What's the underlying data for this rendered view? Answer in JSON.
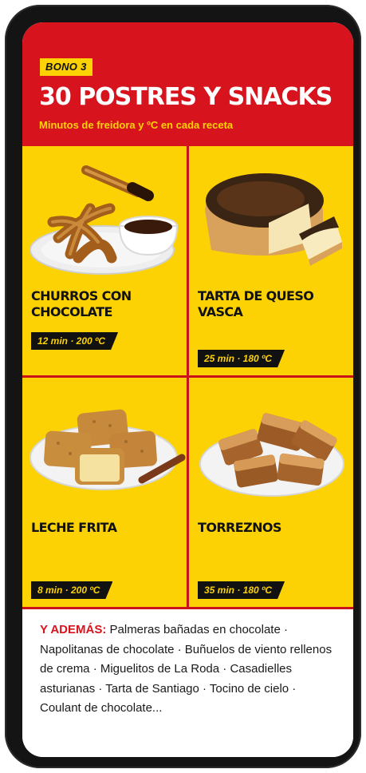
{
  "header": {
    "badge": "BONO 3",
    "title": "30 POSTRES Y SNACKS",
    "subtitle": "Minutos de freidora y ºC en cada receta"
  },
  "cards": [
    {
      "name_line1": "CHURROS CON",
      "name_line2": "CHOCOLATE",
      "tag": "12 min · 200 ºC",
      "image_icon": "churros-chocolate-icon"
    },
    {
      "name_line1": "TARTA DE QUESO",
      "name_line2": "VASCA",
      "tag": "25 min · 180 ºC",
      "image_icon": "cheesecake-icon"
    },
    {
      "name_line1": "LECHE FRITA",
      "name_line2": "",
      "tag": "8 min · 200 ºC",
      "image_icon": "leche-frita-icon"
    },
    {
      "name_line1": "TORREZNOS",
      "name_line2": "",
      "tag": "35 min · 180 ºC",
      "image_icon": "torreznos-icon"
    }
  ],
  "footer": {
    "label": "Y ADEMÁS:",
    "text": " Palmeras bañadas en chocolate · Napolitanas de chocolate · Buñuelos de viento rellenos de crema · Miguelitos de La Roda · Casadielles asturianas · Tarta de Santiago · Tocino de cielo · Coulant de chocolate..."
  },
  "colors": {
    "red": "#d7141d",
    "yellow": "#fcd205",
    "black": "#111111"
  }
}
